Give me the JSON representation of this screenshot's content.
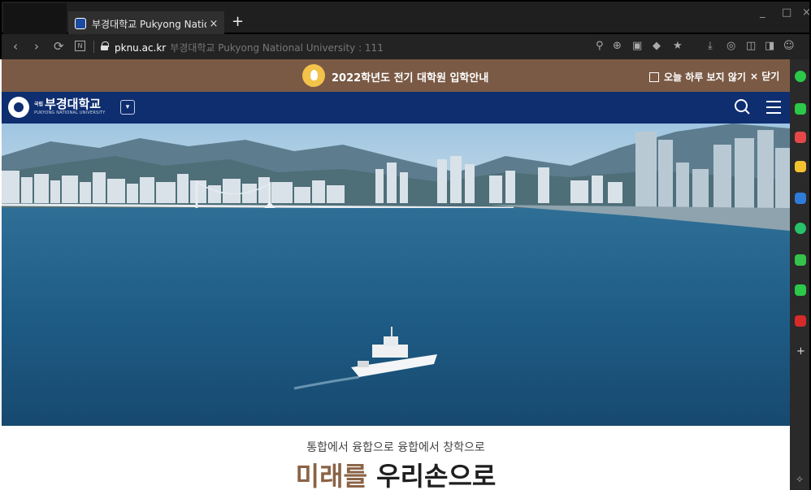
{
  "browser": {
    "tab_title": "부경대학교 Pukyong National U",
    "tab_close": "×",
    "new_tab": "+",
    "url_domain": "pknu.ac.kr",
    "page_title_in_bar": "부경대학교 Pukyong National University : 111",
    "nav": {
      "back": "‹",
      "forward": "›",
      "reload": "⟳"
    },
    "window_controls": {
      "minimize": "_",
      "maximize": "□",
      "close": "×"
    }
  },
  "notice_bar": {
    "text": "2022학년도 전기 대학원 입학안내",
    "dont_show_today": "오늘 하루 보지 않기",
    "close_label": "× 닫기"
  },
  "header": {
    "logo_text": "부경대학교",
    "logo_sub": "PUKYONG NATIONAL UNIVERSITY",
    "logo_prefix": "국립",
    "dropdown_glyph": "▾"
  },
  "hero": {
    "slider": {
      "active_index": 0,
      "slide_count": 2,
      "state": "playing"
    }
  },
  "intro": {
    "subtitle": "통합에서 융합으로 융합에서 창학으로",
    "title_part1": "미래를",
    "title_part2": "우리손으로"
  },
  "side_panel": {
    "icons": [
      "green-ring-icon",
      "chat-icon",
      "pocket-icon",
      "star-icon",
      "translate-icon",
      "play-icon",
      "line-icon",
      "message-icon",
      "news-icon"
    ],
    "add": "+"
  },
  "colors": {
    "notice_bg": "#7a5a45",
    "gnb_bg": "#0e2e70",
    "slogan_brown": "#8a6346"
  }
}
